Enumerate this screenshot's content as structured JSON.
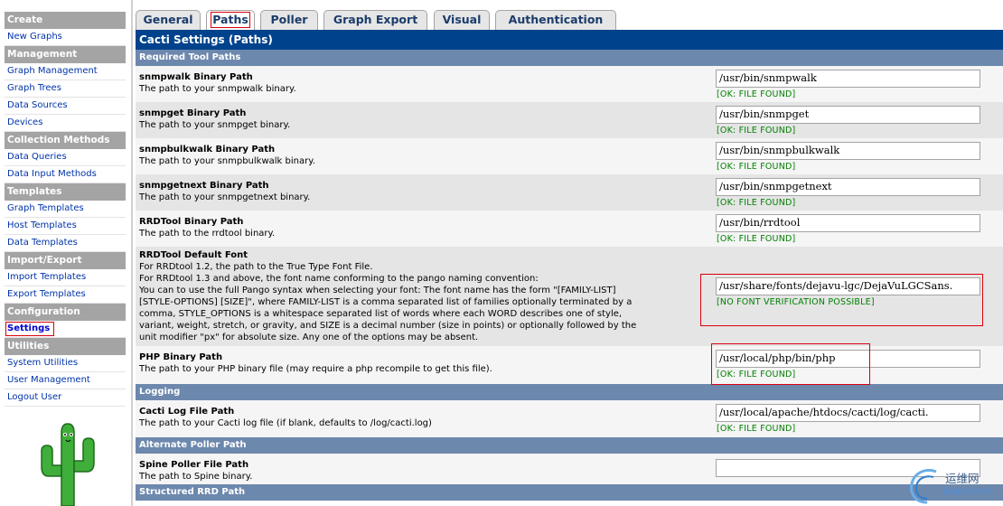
{
  "nav": {
    "sections": [
      {
        "header": "Create",
        "items": [
          "New Graphs"
        ]
      },
      {
        "header": "Management",
        "items": [
          "Graph Management",
          "Graph Trees",
          "Data Sources",
          "Devices"
        ]
      },
      {
        "header": "Collection Methods",
        "items": [
          "Data Queries",
          "Data Input Methods"
        ]
      },
      {
        "header": "Templates",
        "items": [
          "Graph Templates",
          "Host Templates",
          "Data Templates"
        ]
      },
      {
        "header": "Import/Export",
        "items": [
          "Import Templates",
          "Export Templates"
        ]
      },
      {
        "header": "Configuration",
        "items": [
          "Settings"
        ]
      },
      {
        "header": "Utilities",
        "items": [
          "System Utilities",
          "User Management",
          "Logout User"
        ]
      }
    ],
    "active_item": "Settings"
  },
  "tabs": [
    {
      "label": "General"
    },
    {
      "label": "Paths",
      "active": true
    },
    {
      "label": "Poller"
    },
    {
      "label": "Graph Export"
    },
    {
      "label": "Visual"
    },
    {
      "label": "Authentication"
    }
  ],
  "page_title": "Cacti Settings (Paths)",
  "sections": {
    "required_tool_paths": "Required Tool Paths",
    "logging": "Logging",
    "alternate_poller_path": "Alternate Poller Path",
    "structured_rrd_path": "Structured RRD Path"
  },
  "settings": {
    "snmpwalk": {
      "name": "snmpwalk Binary Path",
      "desc": "The path to your snmpwalk binary.",
      "value": "/usr/bin/snmpwalk",
      "status": "[OK: FILE FOUND]"
    },
    "snmpget": {
      "name": "snmpget Binary Path",
      "desc": "The path to your snmpget binary.",
      "value": "/usr/bin/snmpget",
      "status": "[OK: FILE FOUND]"
    },
    "snmpbulkwalk": {
      "name": "snmpbulkwalk Binary Path",
      "desc": "The path to your snmpbulkwalk binary.",
      "value": "/usr/bin/snmpbulkwalk",
      "status": "[OK: FILE FOUND]"
    },
    "snmpgetnext": {
      "name": "snmpgetnext Binary Path",
      "desc": "The path to your snmpgetnext binary.",
      "value": "/usr/bin/snmpgetnext",
      "status": "[OK: FILE FOUND]"
    },
    "rrdtool": {
      "name": "RRDTool Binary Path",
      "desc": "The path to the rrdtool binary.",
      "value": "/usr/bin/rrdtool",
      "status": "[OK: FILE FOUND]"
    },
    "rrdtool_font": {
      "name": "RRDTool Default Font",
      "desc_lines": [
        "For RRDtool 1.2, the path to the True Type Font File.",
        "For RRDtool 1.3 and above, the font name conforming to the pango naming convention:",
        "You can to use the full Pango syntax when selecting your font: The font name has the form \"[FAMILY-LIST]",
        "[STYLE-OPTIONS] [SIZE]\", where FAMILY-LIST is a comma separated list of families optionally terminated by a",
        "comma, STYLE_OPTIONS is a whitespace separated list of words where each WORD describes one of style,",
        "variant, weight, stretch, or gravity, and SIZE is a decimal number (size in points) or optionally followed by the",
        "unit modifier \"px\" for absolute size. Any one of the options may be absent."
      ],
      "value": "/usr/share/fonts/dejavu-lgc/DejaVuLGCSans.",
      "status": "[NO FONT VERIFICATION POSSIBLE]"
    },
    "php": {
      "name": "PHP Binary Path",
      "desc": "The path to your PHP binary file (may require a php recompile to get this file).",
      "value": "/usr/local/php/bin/php",
      "status": "[OK: FILE FOUND]"
    },
    "cacti_log": {
      "name": "Cacti Log File Path",
      "desc": "The path to your Cacti log file (if blank, defaults to /log/cacti.log)",
      "value": "/usr/local/apache/htdocs/cacti/log/cacti.",
      "status": "[OK: FILE FOUND]"
    },
    "spine": {
      "name": "Spine Poller File Path",
      "desc": "The path to Spine binary.",
      "value": ""
    }
  },
  "watermark": {
    "title": "运维网",
    "url": "iyunv.com"
  },
  "colors": {
    "title_bar": "#00438c",
    "section_header": "#6d88ad",
    "nav_header": "#a4a4a4",
    "link": "#0033aa",
    "ok_status": "#008000",
    "highlight": "#d9000c"
  }
}
